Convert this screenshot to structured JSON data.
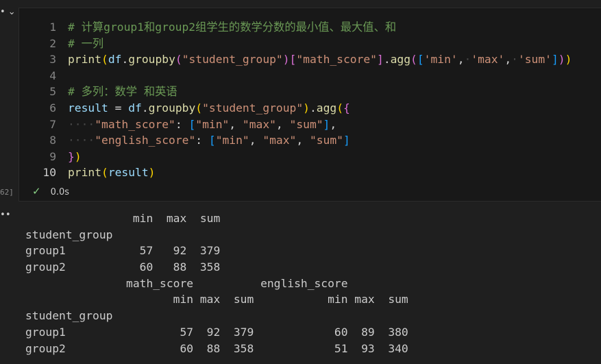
{
  "gutter": {
    "collapse_glyph": "• ⌄",
    "exec_label": "62]",
    "output_glyph": "••"
  },
  "cell": {
    "lines": [
      {
        "num": "1",
        "active": false,
        "tokens": [
          {
            "t": "# 计算group1和group2组学生的数学分数的最小值、最大值、和",
            "c": "cm"
          }
        ]
      },
      {
        "num": "2",
        "active": false,
        "tokens": [
          {
            "t": "# 一列",
            "c": "cm"
          }
        ]
      },
      {
        "num": "3",
        "active": false,
        "tokens": [
          {
            "t": "print",
            "c": "fn"
          },
          {
            "t": "(",
            "c": "p1"
          },
          {
            "t": "df",
            "c": "var"
          },
          {
            "t": ".",
            "c": "op"
          },
          {
            "t": "groupby",
            "c": "fn"
          },
          {
            "t": "(",
            "c": "p2"
          },
          {
            "t": "\"student_group\"",
            "c": "str"
          },
          {
            "t": ")",
            "c": "p2"
          },
          {
            "t": "[",
            "c": "p2"
          },
          {
            "t": "\"math_score\"",
            "c": "str"
          },
          {
            "t": "]",
            "c": "p2"
          },
          {
            "t": ".",
            "c": "op"
          },
          {
            "t": "agg",
            "c": "fn"
          },
          {
            "t": "(",
            "c": "p2"
          },
          {
            "t": "[",
            "c": "p3"
          },
          {
            "t": "'min'",
            "c": "str"
          },
          {
            "t": ",",
            "c": "op"
          },
          {
            "t": "·",
            "c": "dot"
          },
          {
            "t": "'max'",
            "c": "str"
          },
          {
            "t": ",",
            "c": "op"
          },
          {
            "t": "·",
            "c": "dot"
          },
          {
            "t": "'sum'",
            "c": "str"
          },
          {
            "t": "]",
            "c": "p3"
          },
          {
            "t": ")",
            "c": "p2"
          },
          {
            "t": ")",
            "c": "p1"
          }
        ]
      },
      {
        "num": "4",
        "active": false,
        "tokens": []
      },
      {
        "num": "5",
        "active": false,
        "tokens": [
          {
            "t": "# 多列：数学 和英语",
            "c": "cm"
          }
        ]
      },
      {
        "num": "6",
        "active": false,
        "tokens": [
          {
            "t": "result",
            "c": "var"
          },
          {
            "t": " = ",
            "c": "op"
          },
          {
            "t": "df",
            "c": "var"
          },
          {
            "t": ".",
            "c": "op"
          },
          {
            "t": "groupby",
            "c": "fn"
          },
          {
            "t": "(",
            "c": "p1"
          },
          {
            "t": "\"student_group\"",
            "c": "str"
          },
          {
            "t": ")",
            "c": "p1"
          },
          {
            "t": ".",
            "c": "op"
          },
          {
            "t": "agg",
            "c": "fn"
          },
          {
            "t": "(",
            "c": "p1"
          },
          {
            "t": "{",
            "c": "p2"
          }
        ]
      },
      {
        "num": "7",
        "active": false,
        "tokens": [
          {
            "t": "····",
            "c": "dot"
          },
          {
            "t": "\"math_score\"",
            "c": "str"
          },
          {
            "t": ": ",
            "c": "op"
          },
          {
            "t": "[",
            "c": "p3"
          },
          {
            "t": "\"min\"",
            "c": "str"
          },
          {
            "t": ", ",
            "c": "op"
          },
          {
            "t": "\"max\"",
            "c": "str"
          },
          {
            "t": ", ",
            "c": "op"
          },
          {
            "t": "\"sum\"",
            "c": "str"
          },
          {
            "t": "]",
            "c": "p3"
          },
          {
            "t": ",",
            "c": "op"
          }
        ]
      },
      {
        "num": "8",
        "active": false,
        "tokens": [
          {
            "t": "····",
            "c": "dot"
          },
          {
            "t": "\"english_score\"",
            "c": "str"
          },
          {
            "t": ": ",
            "c": "op"
          },
          {
            "t": "[",
            "c": "p3"
          },
          {
            "t": "\"min\"",
            "c": "str"
          },
          {
            "t": ", ",
            "c": "op"
          },
          {
            "t": "\"max\"",
            "c": "str"
          },
          {
            "t": ", ",
            "c": "op"
          },
          {
            "t": "\"sum\"",
            "c": "str"
          },
          {
            "t": "]",
            "c": "p3"
          }
        ]
      },
      {
        "num": "9",
        "active": false,
        "tokens": [
          {
            "t": "}",
            "c": "p2"
          },
          {
            "t": ")",
            "c": "p1"
          }
        ]
      },
      {
        "num": "10",
        "active": true,
        "tokens": [
          {
            "t": "print",
            "c": "fn"
          },
          {
            "t": "(",
            "c": "p1"
          },
          {
            "t": "result",
            "c": "var"
          },
          {
            "t": ")",
            "c": "p1"
          }
        ]
      }
    ]
  },
  "status": {
    "check": "✓",
    "time": "0.0s"
  },
  "output": {
    "lines": [
      "                min  max  sum",
      "student_group",
      "group1           57   92  379",
      "group2           60   88  358",
      "               math_score          english_score",
      "                      min max  sum           min max  sum",
      "student_group",
      "group1                 57  92  379            60  89  380",
      "group2                 60  88  358            51  93  340"
    ]
  }
}
